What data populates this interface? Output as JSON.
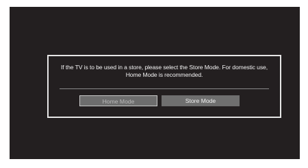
{
  "dialog": {
    "message": "If the TV is to be used in a store, please select the Store Mode. For domestic use, Home Mode is recommended.",
    "buttons": {
      "home_label": "Home Mode",
      "store_label": "Store Mode"
    },
    "selected": "home"
  },
  "colors": {
    "screen_background": "#231f20",
    "dialog_border": "#e6e6e6",
    "button_fill": "#6f6f6f",
    "text": "#f2f2f2"
  }
}
